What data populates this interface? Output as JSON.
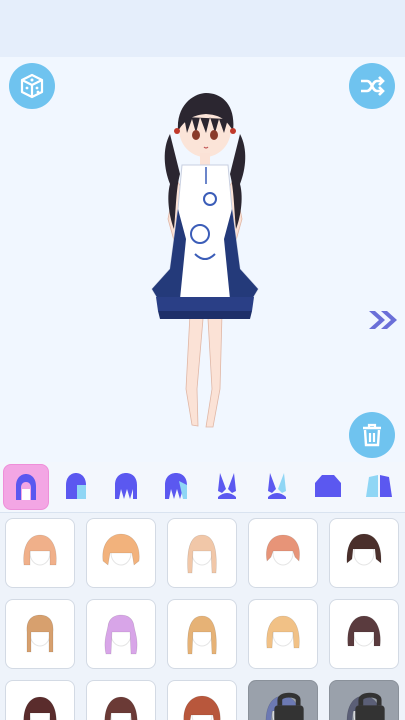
{
  "colors": {
    "accent": "#6fc3ef",
    "tab_icon": "#5b58f0",
    "tab_selected_bg": "#f3a6e4",
    "next_arrow": "#6a6fd8"
  },
  "stage": {
    "random_button_icon": "dice-icon",
    "shuffle_button_icon": "shuffle-icon",
    "next_icon": "double-chevron-right-icon",
    "delete_button_icon": "trash-icon"
  },
  "tabs": [
    {
      "icon": "back-hair-icon",
      "selected": true
    },
    {
      "icon": "front-hair-icon",
      "selected": false
    },
    {
      "icon": "bangs-icon",
      "selected": false
    },
    {
      "icon": "side-hair-icon",
      "selected": false
    },
    {
      "icon": "bunny-ears-icon",
      "selected": false
    },
    {
      "icon": "bunny-ears-alt-icon",
      "selected": false
    },
    {
      "icon": "top-outfit-icon",
      "selected": false
    },
    {
      "icon": "dress-outfit-icon",
      "selected": false
    }
  ],
  "hair_items": [
    {
      "color": "#f0b08a",
      "style": "short-bob",
      "locked": false
    },
    {
      "color": "#f2b27c",
      "style": "fluffy-bob",
      "locked": false
    },
    {
      "color": "#f1c7a8",
      "style": "long-straight",
      "locked": false
    },
    {
      "color": "#e79478",
      "style": "short-messy",
      "locked": false
    },
    {
      "color": "#4a2f2b",
      "style": "short-layered",
      "locked": false
    },
    {
      "color": "#d7a06e",
      "style": "braids",
      "locked": false
    },
    {
      "color": "#d8a5e8",
      "style": "long-wavy",
      "locked": false
    },
    {
      "color": "#e6b276",
      "style": "long-straight",
      "locked": false
    },
    {
      "color": "#f1c186",
      "style": "medium-bob",
      "locked": false
    },
    {
      "color": "#5a3b3e",
      "style": "short-bob",
      "locked": false
    },
    {
      "color": "#5a2c2c",
      "style": "short-bob",
      "locked": false
    },
    {
      "color": "#6b3a36",
      "style": "medium-bob",
      "locked": false
    },
    {
      "color": "#b8573c",
      "style": "fluffy-bob",
      "locked": false
    },
    {
      "color": "#6c79b3",
      "style": "short-layered",
      "locked": true
    },
    {
      "color": "#5b5f77",
      "style": "short-layered",
      "locked": true
    }
  ]
}
